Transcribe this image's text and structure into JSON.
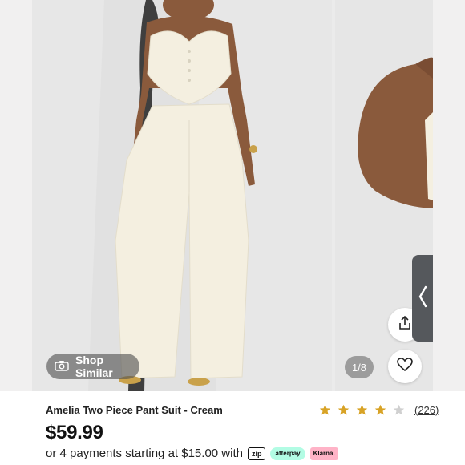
{
  "gallery": {
    "counter": "1/8",
    "shop_similar_label": "Shop Similar"
  },
  "product": {
    "title": "Amelia Two Piece Pant Suit - Cream",
    "price": "$59.99",
    "rating": 4,
    "rating_max": 5,
    "review_count": "(226)",
    "installment_text": "or 4 payments starting at $15.00 with"
  },
  "payment_providers": {
    "zip": "zip",
    "afterpay": "afterpay",
    "klarna": "Klarna."
  },
  "colors": {
    "star_filled": "#d8a326",
    "star_empty": "#d0d0d0",
    "garment": "#f4efe0",
    "skin": "#8a5a3c"
  },
  "icons": [
    "camera-icon",
    "share-icon",
    "heart-icon",
    "chevron-left-icon",
    "star-icon"
  ]
}
